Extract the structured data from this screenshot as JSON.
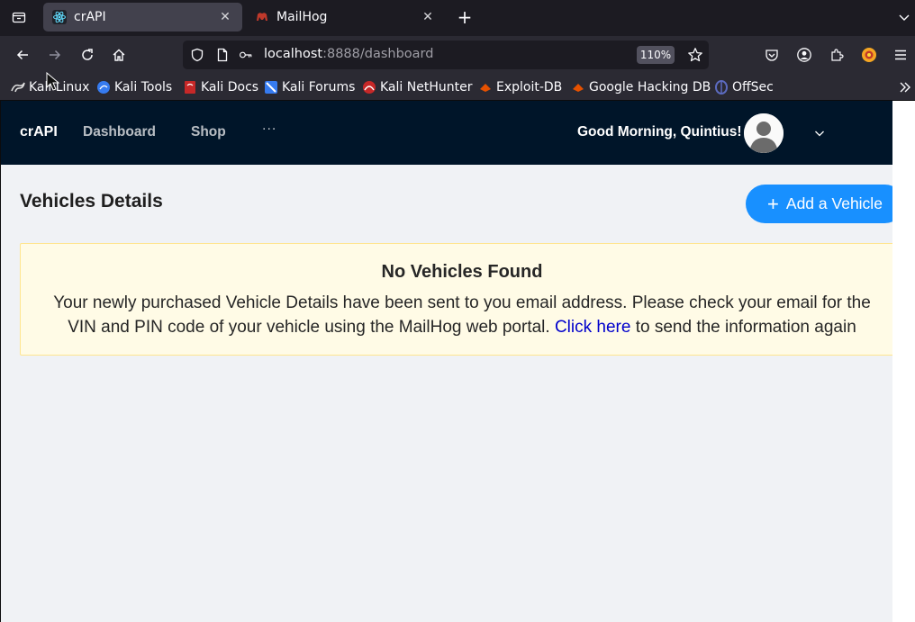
{
  "browser": {
    "tabs": [
      {
        "title": "crAPI",
        "icon": "react-icon",
        "active": true
      },
      {
        "title": "MailHog",
        "icon": "mailhog-icon",
        "active": false
      }
    ],
    "url_host": "localhost",
    "url_rest": ":8888/dashboard",
    "zoom": "110%",
    "bookmarks": [
      {
        "label": "Kali Linux",
        "icon": "kali-dragon-icon"
      },
      {
        "label": "Kali Tools",
        "icon": "kali-tools-icon"
      },
      {
        "label": "Kali Docs",
        "icon": "kali-docs-icon"
      },
      {
        "label": "Kali Forums",
        "icon": "kali-forums-icon"
      },
      {
        "label": "Kali NetHunter",
        "icon": "nethunter-icon"
      },
      {
        "label": "Exploit-DB",
        "icon": "exploit-db-icon"
      },
      {
        "label": "Google Hacking DB",
        "icon": "ghdb-icon"
      },
      {
        "label": "OffSec",
        "icon": "offsec-icon"
      }
    ]
  },
  "app": {
    "brand": "crAPI",
    "menu": [
      "Dashboard",
      "Shop"
    ],
    "menu_more": "···",
    "greeting": "Good Morning, Quintius!",
    "section_title": "Vehicles Details",
    "add_vehicle_label": "Add a Vehicle",
    "add_vehicle_icon": "+",
    "alert": {
      "title": "No Vehicles Found",
      "body_before": "Your newly purchased Vehicle Details have been sent to you email address. Please check your email for the VIN and PIN code of your vehicle using the MailHog web portal. ",
      "link_text": "Click here",
      "body_after": " to send the information again"
    }
  },
  "colors": {
    "header_bg": "#001529",
    "primary": "#1890ff",
    "alert_bg": "#fffbe6",
    "alert_border": "#ffe58f",
    "link": "#0000cc"
  }
}
